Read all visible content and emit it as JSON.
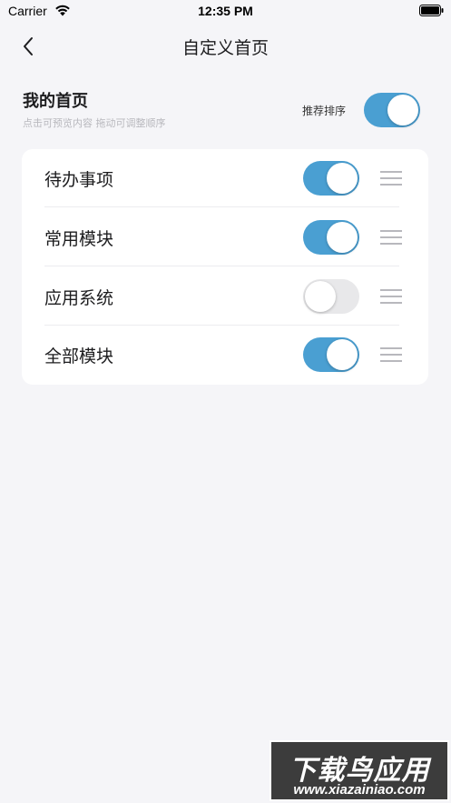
{
  "status_bar": {
    "carrier": "Carrier",
    "time": "12:35 PM",
    "wifi_icon": "wifi-icon",
    "battery_icon": "battery-icon"
  },
  "nav": {
    "title": "自定义首页",
    "back_icon": "chevron-left-icon"
  },
  "home": {
    "title": "我的首页",
    "subtitle": "点击可预览内容 拖动可调整顺序",
    "recommend_label": "推荐排序",
    "recommend_on": true
  },
  "modules": [
    {
      "label": "待办事项",
      "enabled": true
    },
    {
      "label": "常用模块",
      "enabled": true
    },
    {
      "label": "应用系统",
      "enabled": false
    },
    {
      "label": "全部模块",
      "enabled": true
    }
  ],
  "watermark": {
    "line1": "下载鸟应用",
    "line2": "www.xiazainiao.com"
  },
  "colors": {
    "accent": "#4a9fd2",
    "toggle_off": "#e8e8ea",
    "background": "#f5f5f8",
    "card": "#ffffff",
    "muted_text": "#b8b8bd"
  }
}
